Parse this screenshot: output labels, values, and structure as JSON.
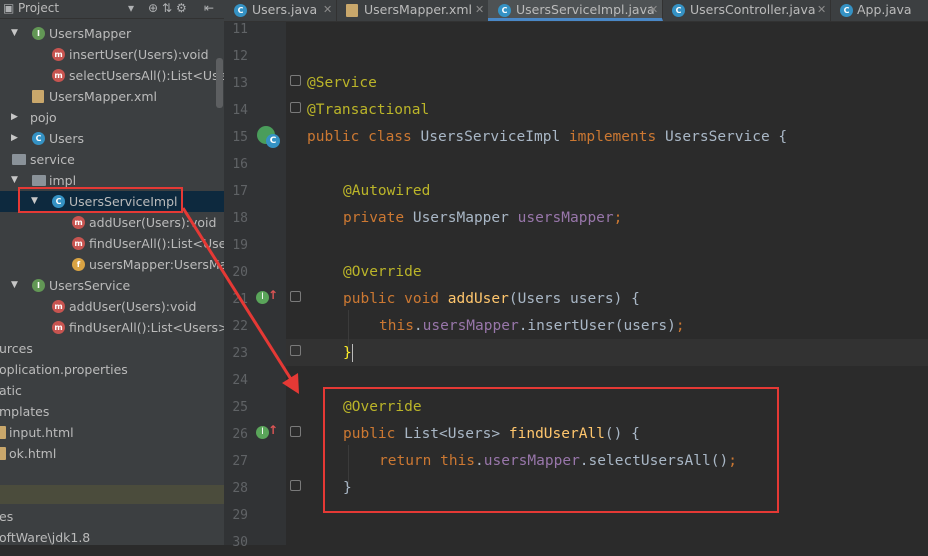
{
  "project_panel": {
    "title": "Project",
    "header_buttons": [
      "⊕",
      "⇅",
      "⚙",
      "⇤"
    ],
    "tree": [
      {
        "label": "UsersMapper",
        "icon": "interface-icon",
        "arrow": "▼"
      },
      {
        "label": "insertUser(Users):void",
        "icon": "method-icon"
      },
      {
        "label": "selectUsersAll():List<Users>",
        "icon": "method-icon"
      },
      {
        "label": "UsersMapper.xml",
        "icon": "xml-file-icon"
      },
      {
        "label": "pojo",
        "icon": "folder-icon",
        "arrow": "▶"
      },
      {
        "label": "Users",
        "icon": "class-icon",
        "arrow": "▶"
      },
      {
        "label": "service",
        "icon": "folder-icon",
        "arrow": "▼"
      },
      {
        "label": "impl",
        "icon": "folder-icon",
        "arrow": "▼"
      },
      {
        "label": "UsersServiceImpl",
        "icon": "class-icon",
        "arrow": "▼",
        "selected": true
      },
      {
        "label": "addUser(Users):void",
        "icon": "method-icon"
      },
      {
        "label": "findUserAll():List<Users>",
        "icon": "method-icon"
      },
      {
        "label": "usersMapper:UsersMapper",
        "icon": "field-icon"
      },
      {
        "label": "UsersService",
        "icon": "interface-icon",
        "arrow": "▼"
      },
      {
        "label": "addUser(Users):void",
        "icon": "method-icon"
      },
      {
        "label": "findUserAll():List<Users>",
        "icon": "method-icon"
      },
      {
        "label": "urces"
      },
      {
        "label": "oplication.properties"
      },
      {
        "label": "atic"
      },
      {
        "label": "mplates"
      },
      {
        "label": "input.html",
        "icon": "html-file-icon"
      },
      {
        "label": "ok.html",
        "icon": "html-file-icon"
      },
      {
        "label": ""
      },
      {
        "label": ""
      },
      {
        "label": "es"
      },
      {
        "label": "oftWare\\jdk1.8"
      }
    ]
  },
  "tabs": [
    {
      "label": "Users.java",
      "icon": "class-icon"
    },
    {
      "label": "UsersMapper.xml",
      "icon": "xml-file-icon"
    },
    {
      "label": "UsersServiceImpl.java",
      "icon": "class-icon",
      "active": true
    },
    {
      "label": "UsersController.java",
      "icon": "class-icon"
    },
    {
      "label": "App.java",
      "icon": "class-icon"
    }
  ],
  "editor": {
    "line_numbers": [
      "11",
      "12",
      "13",
      "14",
      "15",
      "16",
      "17",
      "18",
      "19",
      "20",
      "21",
      "22",
      "23",
      "24",
      "25",
      "26",
      "27",
      "28",
      "29",
      "30"
    ],
    "lines": {
      "l13": "@Service",
      "l14": "@Transactional",
      "l15": [
        "public class ",
        "UsersServiceImpl ",
        "implements ",
        "UsersService {"
      ],
      "l17": "@Autowired",
      "l18": [
        "private ",
        "UsersMapper ",
        "usersMapper",
        ";"
      ],
      "l20": "@Override",
      "l21": [
        "public void ",
        "addUser",
        "(Users users) {"
      ],
      "l22": [
        "this",
        ".",
        "usersMapper",
        ".insertUser(users)",
        ";"
      ],
      "l23": "}",
      "l25": "@Override",
      "l26": [
        "public ",
        "List<Users> ",
        "findUserAll",
        "() {"
      ],
      "l27": [
        "return this",
        ".",
        "usersMapper",
        ".selectUsersAll()",
        ";"
      ],
      "l28": "}"
    }
  },
  "colors": {
    "annotation_red": "#e53935",
    "keyword": "#cc7832",
    "annotation": "#bbb529",
    "field": "#9876aa",
    "method": "#ffc66d"
  }
}
